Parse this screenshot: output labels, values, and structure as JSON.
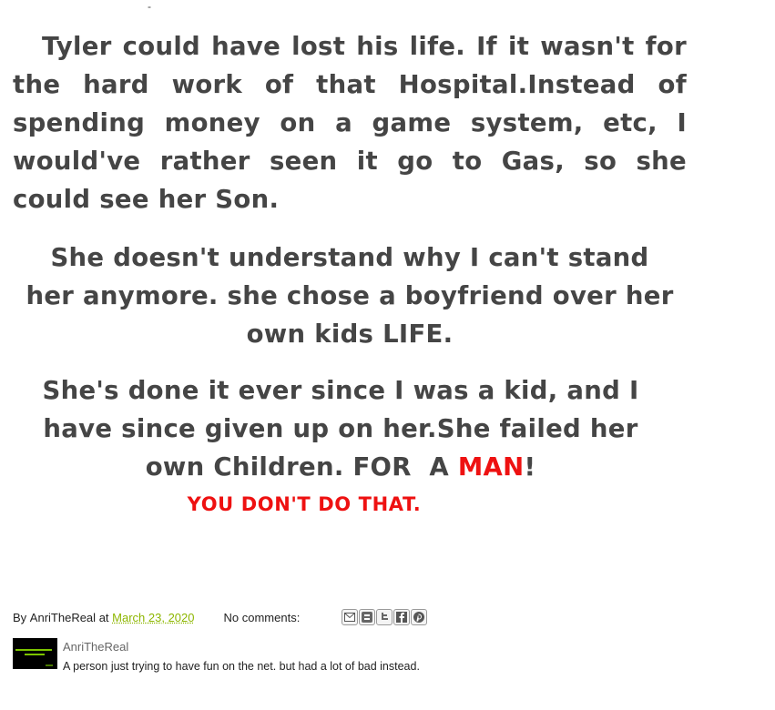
{
  "header": {
    "stray_mark": "-"
  },
  "post": {
    "paragraph1": "Tyler could have lost his life. If it wasn't for the hard work of that Hospital.Instead of spending money on a game system, etc, I would've rather seen it go to Gas, so she could see her Son.",
    "paragraph2_line1": "She doesn't understand why I  can't stand",
    "paragraph2_line2": "her anymore. she chose  a boyfriend over her",
    "paragraph2_line3": "own kids LIFE.",
    "paragraph3_line1": "She's done it ever since I was a kid, and I",
    "paragraph3_line2": "have since given up on her.She failed her",
    "paragraph3_line3_prefix": "own Children. FOR  A ",
    "paragraph3_emphasis": "MAN",
    "paragraph3_suffix": "!",
    "shout": "YOU DON'T DO THAT.",
    "text_color": "#454545",
    "accent_color": "#ee1111"
  },
  "footer": {
    "by_prefix": "By",
    "author": "AnriTheReal",
    "at_label": "at",
    "date": "March 23, 2020",
    "comments": "No comments:",
    "link_color": "#8db600",
    "share_icons": [
      "email-icon",
      "blogger-icon",
      "twitter-icon",
      "facebook-icon",
      "pinterest-icon"
    ]
  },
  "author_profile": {
    "name": "AnriTheReal",
    "description": "A person just trying to have fun on the net. but had a lot of bad instead."
  }
}
